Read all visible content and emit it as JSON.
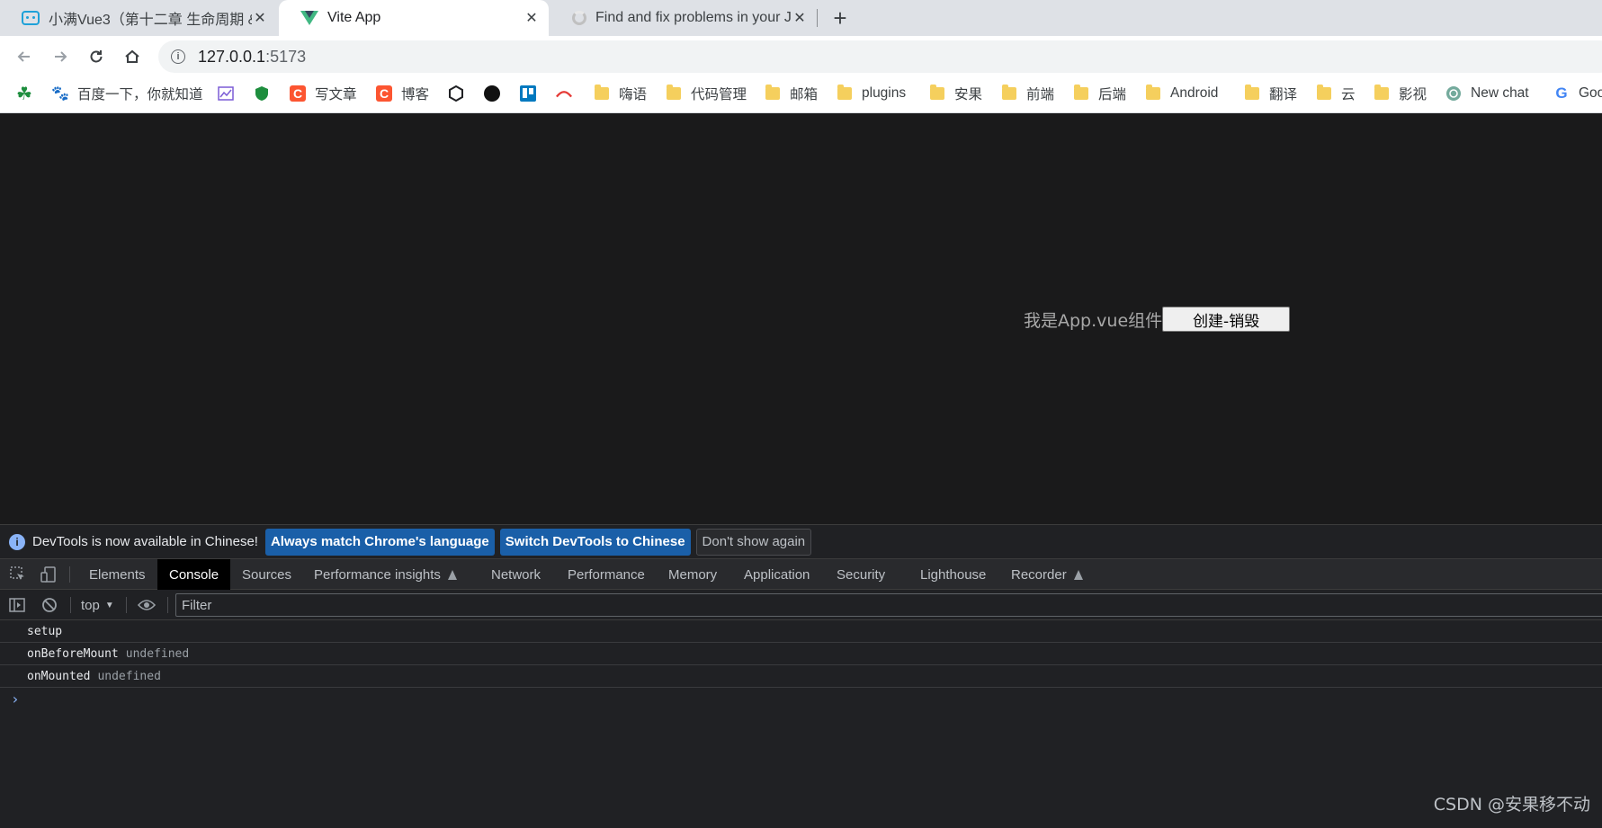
{
  "browser": {
    "tabs": [
      {
        "title": "小满Vue3（第十二章 生命周期 &",
        "icon": "bilibili-icon",
        "active": false
      },
      {
        "title": "Vite App",
        "icon": "vue-icon",
        "active": true
      },
      {
        "title": "Find and fix problems in your J",
        "icon": "loading-icon",
        "active": false
      }
    ],
    "tab_close_glyph": "✕",
    "new_tab_glyph": "+",
    "url_host": "127.0.0.1",
    "url_port": ":5173"
  },
  "bookmarks": [
    {
      "label": "",
      "icon": "clover-icon"
    },
    {
      "label": "百度一下，你就知道",
      "icon": "baidu-icon"
    },
    {
      "label": "",
      "icon": "chart-icon"
    },
    {
      "label": "",
      "icon": "shield-icon"
    },
    {
      "label": "写文章",
      "icon": "csdn-icon"
    },
    {
      "label": "博客",
      "icon": "csdn-icon"
    },
    {
      "label": "",
      "icon": "hexagon-icon"
    },
    {
      "label": "",
      "icon": "compass-icon"
    },
    {
      "label": "",
      "icon": "trello-icon"
    },
    {
      "label": "",
      "icon": "cloud-icon"
    },
    {
      "label": "嗨语",
      "icon": "folder-icon"
    },
    {
      "label": "代码管理",
      "icon": "folder-icon"
    },
    {
      "label": "邮箱",
      "icon": "folder-icon"
    },
    {
      "label": "plugins",
      "icon": "folder-icon"
    },
    {
      "label": "安果",
      "icon": "folder-icon"
    },
    {
      "label": "前端",
      "icon": "folder-icon"
    },
    {
      "label": "后端",
      "icon": "folder-icon"
    },
    {
      "label": "Android",
      "icon": "folder-icon"
    },
    {
      "label": "翻译",
      "icon": "folder-icon"
    },
    {
      "label": "云",
      "icon": "folder-icon"
    },
    {
      "label": "影视",
      "icon": "folder-icon"
    },
    {
      "label": "New chat",
      "icon": "openai-icon"
    },
    {
      "label": "Goo",
      "icon": "google-icon"
    }
  ],
  "page": {
    "component_label": "我是App.vue组件",
    "toggle_button": "创建-销毁"
  },
  "devtools": {
    "infobar": {
      "message": "DevTools is now available in Chinese!",
      "btn_match": "Always match Chrome's language",
      "btn_switch": "Switch DevTools to Chinese",
      "btn_dismiss": "Don't show again"
    },
    "tabs": [
      {
        "label": "Elements"
      },
      {
        "label": "Console",
        "active": true
      },
      {
        "label": "Sources"
      },
      {
        "label": "Performance insights",
        "experimental": true
      },
      {
        "label": "Network"
      },
      {
        "label": "Performance"
      },
      {
        "label": "Memory"
      },
      {
        "label": "Application"
      },
      {
        "label": "Security"
      },
      {
        "label": "Lighthouse"
      },
      {
        "label": "Recorder",
        "experimental": true
      }
    ],
    "context": "top",
    "filter_placeholder": "Filter",
    "messages": [
      {
        "text": "setup",
        "arg": ""
      },
      {
        "text": "onBeforeMount",
        "arg": "undefined"
      },
      {
        "text": "onMounted",
        "arg": "undefined"
      }
    ],
    "prompt_glyph": "›"
  },
  "watermark": "CSDN @安果移不动",
  "colors": {
    "page_bg": "#1a1a1b",
    "devtools_bg": "#202124",
    "primary_button": "#1a5fa8",
    "link_blue": "#8ab4f8"
  }
}
